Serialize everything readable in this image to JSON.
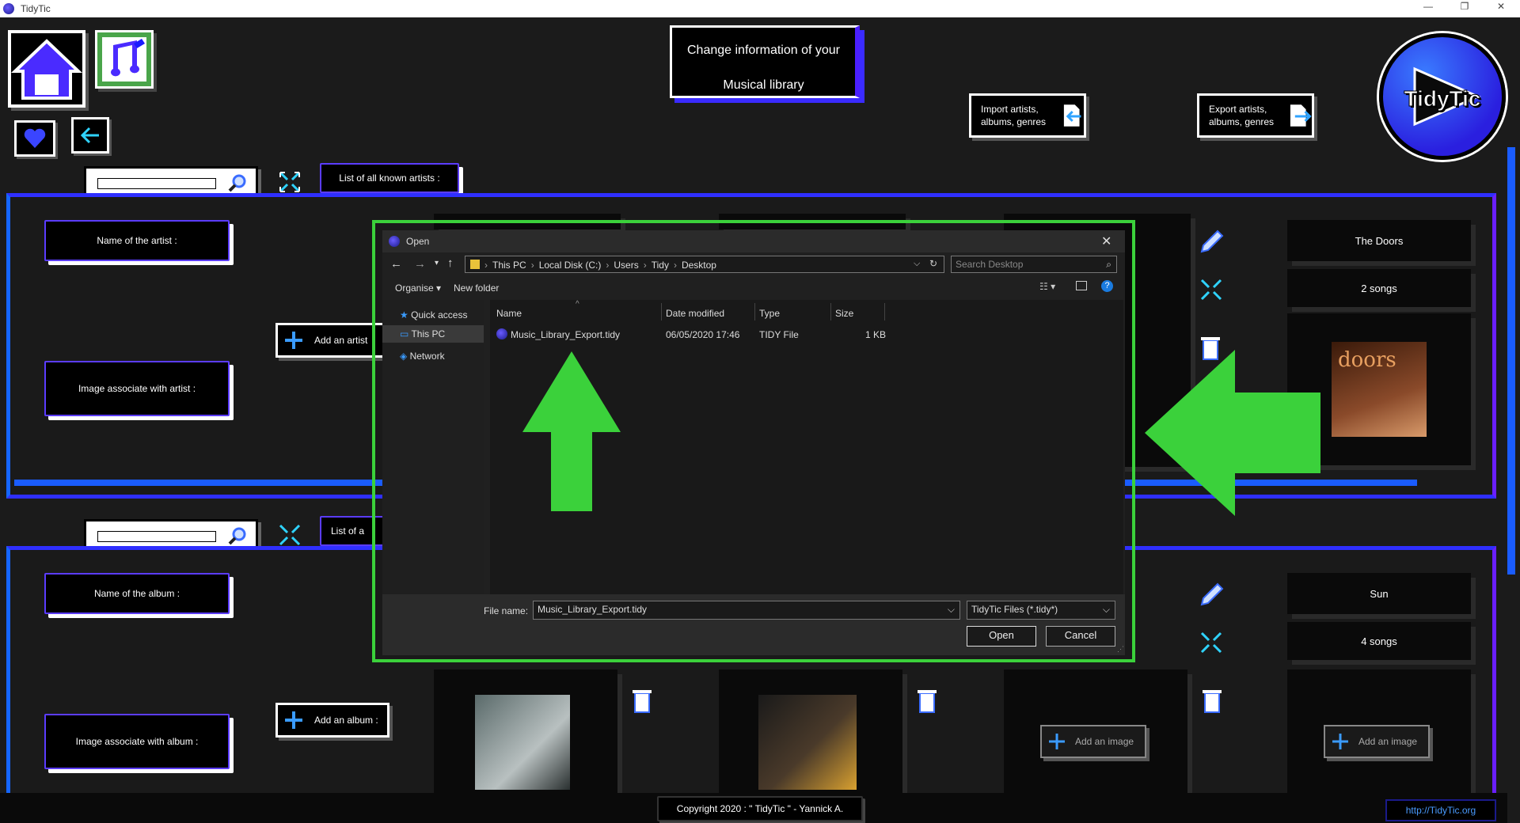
{
  "window": {
    "title": "TidyTic",
    "controls": [
      "—",
      "❐",
      "✕"
    ]
  },
  "header": {
    "title_line1": "Change information of your",
    "title_line2": "Musical library",
    "import_label": "Import artists, albums, genres",
    "export_label": "Export artists, albums, genres",
    "logo_text": "TidyTic"
  },
  "artists": {
    "search_placeholder": "",
    "list_label": "List of all known artists :",
    "name_label": "Name of the artist :",
    "image_label": "Image associate with artist :",
    "add_button": "Add an artist",
    "card": {
      "name": "The Doors",
      "songs": "2 songs",
      "add_image": "Add an image"
    }
  },
  "albums": {
    "search_placeholder": "",
    "list_label": "List of a",
    "name_label": "Name of the album :",
    "image_label": "Image associate with album :",
    "add_button": "Add an album :",
    "card": {
      "name": "Sun",
      "songs": "4 songs",
      "add_image": "Add an image"
    },
    "add_image_label": "Add an image"
  },
  "footer": {
    "copyright": "Copyright 2020 : \" TidyTic \" - Yannick A.",
    "link": "http://TidyTic.org"
  },
  "dialog": {
    "title": "Open",
    "breadcrumb": [
      "This PC",
      "Local Disk (C:)",
      "Users",
      "Tidy",
      "Desktop"
    ],
    "search_placeholder": "Search Desktop",
    "toolbar": {
      "organise": "Organise",
      "new_folder": "New folder"
    },
    "nav": [
      "Quick access",
      "This PC",
      "Network"
    ],
    "columns": [
      "Name",
      "Date modified",
      "Type",
      "Size"
    ],
    "files": [
      {
        "name": "Music_Library_Export.tidy",
        "date": "06/05/2020 17:46",
        "type": "TIDY File",
        "size": "1 KB"
      }
    ],
    "file_name_label": "File name:",
    "file_name_value": "Music_Library_Export.tidy",
    "filter": "TidyTic Files (*.tidy*)",
    "open_button": "Open",
    "cancel_button": "Cancel"
  },
  "colors": {
    "accent_blue": "#2f2fff",
    "accent_purple": "#6a1fff",
    "highlight_green": "#3bd13b"
  }
}
